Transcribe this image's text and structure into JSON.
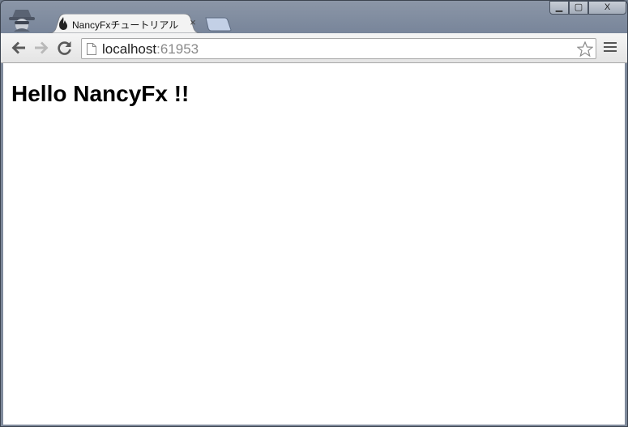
{
  "browser": {
    "tab": {
      "title": "NancyFxチュートリアル",
      "close_glyph": "×",
      "favicon": "nancy-favicon-icon"
    },
    "window_controls": {
      "minimize_glyph": "▁",
      "maximize_glyph": "▢",
      "close_glyph": "X"
    },
    "toolbar": {
      "back_icon": "back-arrow-icon",
      "forward_icon": "forward-arrow-icon",
      "reload_icon": "reload-icon",
      "star_icon": "star-icon",
      "menu_icon": "menu-icon"
    },
    "omnibox": {
      "host": "localhost",
      "port": ":61953"
    },
    "incognito_icon": "incognito-icon"
  },
  "page": {
    "heading": "Hello NancyFx !!"
  }
}
